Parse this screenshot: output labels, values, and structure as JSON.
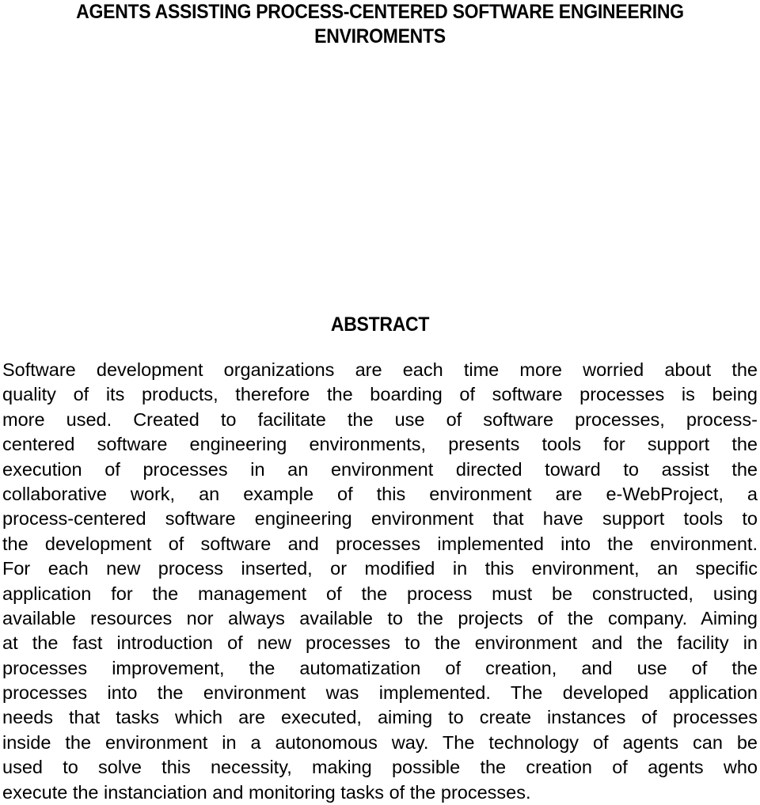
{
  "document": {
    "title_lines": [
      "AGENTS ASSISTING PROCESS-CENTERED SOFTWARE ENGINEERING",
      "ENVIROMENTS"
    ],
    "abstract": {
      "heading": "ABSTRACT",
      "lines": [
        "Software development organizations are each time more worried about the",
        "quality of its products, therefore the boarding of software processes is being",
        "more used. Created to facilitate the use of software processes, process-",
        "centered software engineering environments, presents tools for support the",
        "execution of processes in an environment directed toward to assist the",
        "collaborative work, an example of this environment are e-WebProject, a",
        "process-centered software engineering environment that have support tools to",
        "the development of software and processes implemented into the environment.",
        "For each new process inserted, or modified in this environment, an specific",
        "application for the management of the process must be constructed, using",
        "available resources nor always available to the projects of the company. Aiming",
        "at the fast introduction of new processes to the environment and the facility in",
        "processes improvement, the automatization of creation, and use of the",
        "processes into the environment was implemented. The developed application",
        "needs that tasks which are executed, aiming to create instances of processes",
        "inside the environment in a autonomous way. The technology of agents can be",
        "used to solve this necessity, making possible the creation of agents who",
        "execute the instanciation and monitoring tasks of the processes."
      ]
    }
  }
}
